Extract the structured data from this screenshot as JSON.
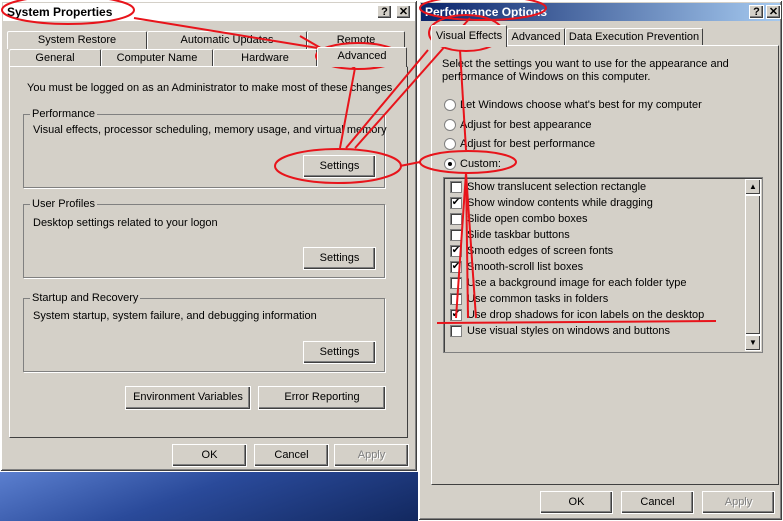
{
  "system_properties": {
    "title": "System Properties",
    "tabs_back": [
      "System Restore",
      "Automatic Updates",
      "Remote"
    ],
    "tabs_front": [
      "General",
      "Computer Name",
      "Hardware",
      "Advanced"
    ],
    "admin_note": "You must be logged on as an Administrator to make most of these changes.",
    "performance": {
      "title": "Performance",
      "desc": "Visual effects, processor scheduling, memory usage, and virtual memory",
      "button": "Settings"
    },
    "user_profiles": {
      "title": "User Profiles",
      "desc": "Desktop settings related to your logon",
      "button": "Settings"
    },
    "startup": {
      "title": "Startup and Recovery",
      "desc": "System startup, system failure, and debugging information",
      "button": "Settings"
    },
    "env_button": "Environment Variables",
    "error_button": "Error Reporting",
    "ok": "OK",
    "cancel": "Cancel",
    "apply": "Apply"
  },
  "performance_options": {
    "title": "Performance Options",
    "tabs": [
      "Visual Effects",
      "Advanced",
      "Data Execution Prevention"
    ],
    "intro": [
      "Select the settings you want to use for the appearance and",
      "performance of Windows on this computer."
    ],
    "radios": [
      {
        "label": "Let Windows choose what's best for my computer",
        "selected": false
      },
      {
        "label": "Adjust for best appearance",
        "selected": false
      },
      {
        "label": "Adjust for best performance",
        "selected": false
      },
      {
        "label": "Custom:",
        "selected": true
      }
    ],
    "effects": [
      {
        "label": "Show translucent selection rectangle",
        "checked": false
      },
      {
        "label": "Show window contents while dragging",
        "checked": true
      },
      {
        "label": "Slide open combo boxes",
        "checked": false
      },
      {
        "label": "Slide taskbar buttons",
        "checked": false
      },
      {
        "label": "Smooth edges of screen fonts",
        "checked": true
      },
      {
        "label": "Smooth-scroll list boxes",
        "checked": true
      },
      {
        "label": "Use a background image for each folder type",
        "checked": false
      },
      {
        "label": "Use common tasks in folders",
        "checked": false
      },
      {
        "label": "Use drop shadows for icon labels on the desktop",
        "checked": true
      },
      {
        "label": "Use visual styles on windows and buttons",
        "checked": false
      }
    ],
    "ok": "OK",
    "cancel": "Cancel",
    "apply": "Apply"
  },
  "colors": {
    "annotation": "#e8141b",
    "title_active": "#0a246a",
    "face": "#d4d0c8"
  }
}
